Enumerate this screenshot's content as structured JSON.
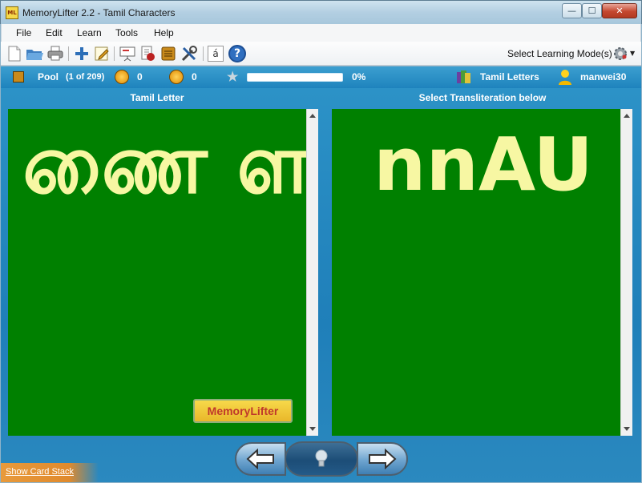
{
  "window": {
    "icon_text": "ML",
    "title": "MemoryLifter 2.2 - Tamil Characters",
    "controls": {
      "minimize": "—",
      "maximize": "☐",
      "close": "✕"
    }
  },
  "menu": [
    "File",
    "Edit",
    "Learn",
    "Tools",
    "Help"
  ],
  "toolbar": {
    "icons": [
      "new-document-icon",
      "open-folder-icon",
      "print-icon",
      "add-card-icon",
      "edit-card-icon",
      "presentation-icon",
      "statistics-icon",
      "card-box-icon",
      "tools-icon",
      "special-char-icon",
      "help-icon"
    ],
    "special_char_glyph": "á",
    "help_glyph": "?",
    "mode_label": "Select Learning Mode(s)"
  },
  "status": {
    "pool_label": "Pool",
    "pool_count": "(1 of 209)",
    "right_count": "0",
    "wrong_count": "0",
    "progress_percent": 0,
    "progress_label": "0%",
    "dictionary_name": "Tamil Letters",
    "user_name": "manwei30"
  },
  "panels": {
    "left_heading": "Tamil Letter",
    "right_heading": "Select Transliteration below",
    "question": "ணை ள",
    "answer": "nnAU",
    "logo_text": "MemoryLifter"
  },
  "bottom": {
    "show_card_stack": "Show Card Stack"
  },
  "colors": {
    "card_background": "#008000",
    "card_text": "#f7f7a3",
    "status_bar": "#2590c6"
  }
}
